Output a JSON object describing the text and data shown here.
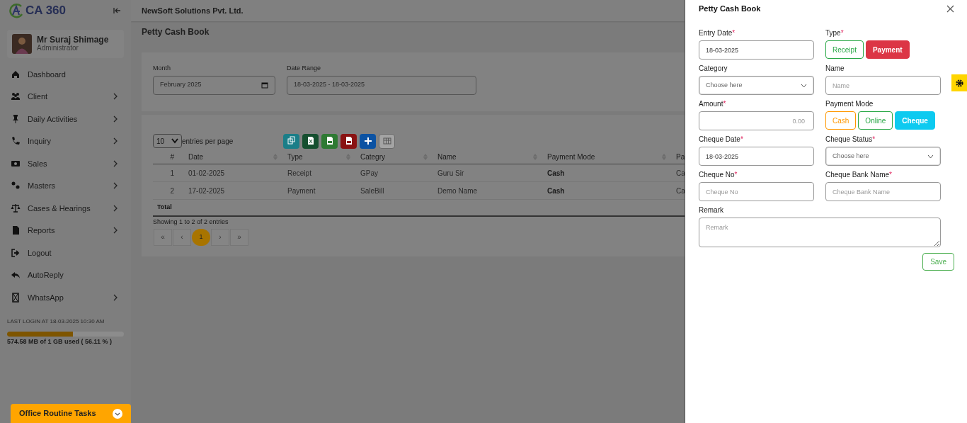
{
  "sidebar": {
    "logo": "CA 360",
    "user": {
      "name": "Mr Suraj Shimage",
      "role": "Administrator"
    },
    "nav": [
      {
        "label": "Dashboard",
        "submenu": false
      },
      {
        "label": "Client",
        "submenu": true
      },
      {
        "label": "Daily Activities",
        "submenu": true
      },
      {
        "label": "Inquiry",
        "submenu": true
      },
      {
        "label": "Sales",
        "submenu": true
      },
      {
        "label": "Masters",
        "submenu": true
      },
      {
        "label": "Cases & Hearings",
        "submenu": true
      },
      {
        "label": "Reports",
        "submenu": true
      },
      {
        "label": "Logout",
        "submenu": false
      },
      {
        "label": "AutoReply",
        "submenu": false
      },
      {
        "label": "WhatsApp",
        "submenu": true
      }
    ],
    "last_login": "LAST LOGIN AT 18-03-2025 10:30 AM",
    "storage": {
      "level": 0.5611,
      "text": "574.58 MB of 1 GB used ( 56.11 % )"
    },
    "office_tasks": "Office Routine Tasks"
  },
  "topbar": {
    "company": "NewSoft Solutions Pvt. Ltd."
  },
  "page_title": "Petty Cash Book",
  "filters": [
    {
      "label": "Month",
      "value": "February 2025",
      "kind": "month"
    },
    {
      "label": "Date Range",
      "value": "18-03-2025 - 18-03-2025",
      "kind": "range"
    }
  ],
  "table": {
    "page_size": "10",
    "entries_label": "entries per page",
    "tools": [
      {
        "kind": "copy",
        "disabled": false
      },
      {
        "kind": "excel",
        "disabled": false
      },
      {
        "kind": "csv",
        "disabled": false
      },
      {
        "kind": "pdf",
        "disabled": false
      },
      {
        "kind": "add",
        "disabled": false
      },
      {
        "kind": "columns",
        "disabled": true
      }
    ],
    "columns": [
      "#",
      "Date",
      "Type",
      "Categry",
      "Name",
      "Payment Mode",
      "Pa"
    ],
    "rows": [
      [
        "1",
        "01-02-2025",
        "Receipt",
        "GPay",
        "Guru Sir",
        "Cash",
        "Ca"
      ],
      [
        "2",
        "17-02-2025",
        "Payment",
        "SaleBill",
        "Demo Name",
        "Cash",
        "Ca"
      ]
    ],
    "total": "Total",
    "info": "Showing 1 to 2 of 2 entries",
    "pagination": [
      {
        "label": "«",
        "selected": false
      },
      {
        "label": "‹",
        "selected": false
      },
      {
        "label": "1",
        "selected": true
      },
      {
        "label": "›",
        "selected": false
      },
      {
        "label": "»",
        "selected": false
      }
    ]
  },
  "panel": {
    "title": "Petty Cash Book",
    "fields": [
      {
        "kind": "text",
        "label": "Entry Date",
        "required_mark": "*",
        "value": "18-03-2025"
      },
      {
        "kind": "toggle",
        "label": "Type",
        "required_mark": "*",
        "options": [
          {
            "label": "Receipt",
            "color": "#28a745",
            "selected": false
          },
          {
            "label": "Payment",
            "color": "#dc3545",
            "selected": true
          }
        ]
      },
      {
        "kind": "select",
        "label": "Category",
        "placeholder": "Choose here"
      },
      {
        "kind": "text",
        "label": "Name",
        "placeholder": "Name"
      },
      {
        "kind": "amount",
        "label": "Amount",
        "required_mark": "*",
        "placeholder": "0.00"
      },
      {
        "kind": "toggle",
        "label": "Payment Mode",
        "options": [
          {
            "label": "Cash",
            "color": "#ff9800",
            "selected": false
          },
          {
            "label": "Online",
            "color": "#28a745",
            "selected": false
          },
          {
            "label": "Cheque",
            "color": "#0dcaf0",
            "selected": true
          }
        ]
      },
      {
        "kind": "text",
        "label": "Cheque Date",
        "required_mark": "*",
        "value": "18-03-2025"
      },
      {
        "kind": "select",
        "label": "Cheque Status",
        "required_mark": "*",
        "placeholder": "Choose here"
      },
      {
        "kind": "text",
        "label": "Cheque No",
        "required_mark": "*",
        "placeholder": "Cheque No"
      },
      {
        "kind": "text",
        "label": "Cheque Bank Name",
        "required_mark": "*",
        "placeholder": "Cheque Bank Name"
      },
      {
        "kind": "textarea",
        "label": "Remark",
        "placeholder": "Remark"
      }
    ],
    "save": "Save"
  }
}
